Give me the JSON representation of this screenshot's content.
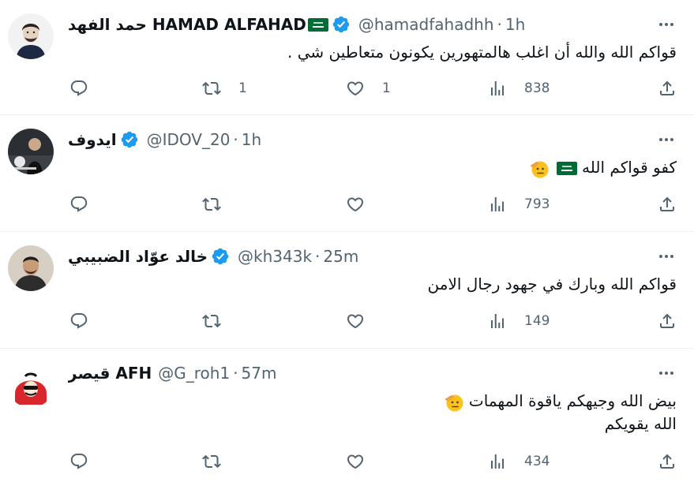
{
  "tweets": [
    {
      "name": "حمد الفهد HAMAD ALFAHAD",
      "handle": "@hamadfahadhh",
      "time": "1h",
      "text": "قواكم الله والله أن اغلب هالمتهورين يكونون متعاطين شي .",
      "replies": "",
      "retweets": "1",
      "likes": "1",
      "views": "838"
    },
    {
      "name": "ايدوف",
      "handle": "@IDOV_20",
      "time": "1h",
      "text": "كفو قواكم الله",
      "replies": "",
      "retweets": "",
      "likes": "",
      "views": "793"
    },
    {
      "name": "خالد عوّاد الضبيبي",
      "handle": "@kh343k",
      "time": "25m",
      "text": "قواكم الله وبارك في جهود رجال الامن",
      "replies": "",
      "retweets": "",
      "likes": "",
      "views": "149"
    },
    {
      "name": "قيصر AFH",
      "handle": "@G_roh1",
      "time": "57m",
      "text_line1": "بيض الله وجيهكم ياقوة المهمات",
      "text_line2": "الله يقويكم",
      "replies": "",
      "retweets": "",
      "likes": "",
      "views": "434"
    }
  ],
  "labels": {
    "separator": "·"
  },
  "colors": {
    "verified": "#1d9bf0",
    "muted": "#536471",
    "divider": "#eff3f4",
    "flag": "#006c35"
  },
  "icons": [
    "reply-icon",
    "retweet-icon",
    "like-icon",
    "views-icon",
    "share-icon",
    "more-icon",
    "verified-badge-icon",
    "saudi-flag-icon",
    "saluting-face-emoji"
  ]
}
